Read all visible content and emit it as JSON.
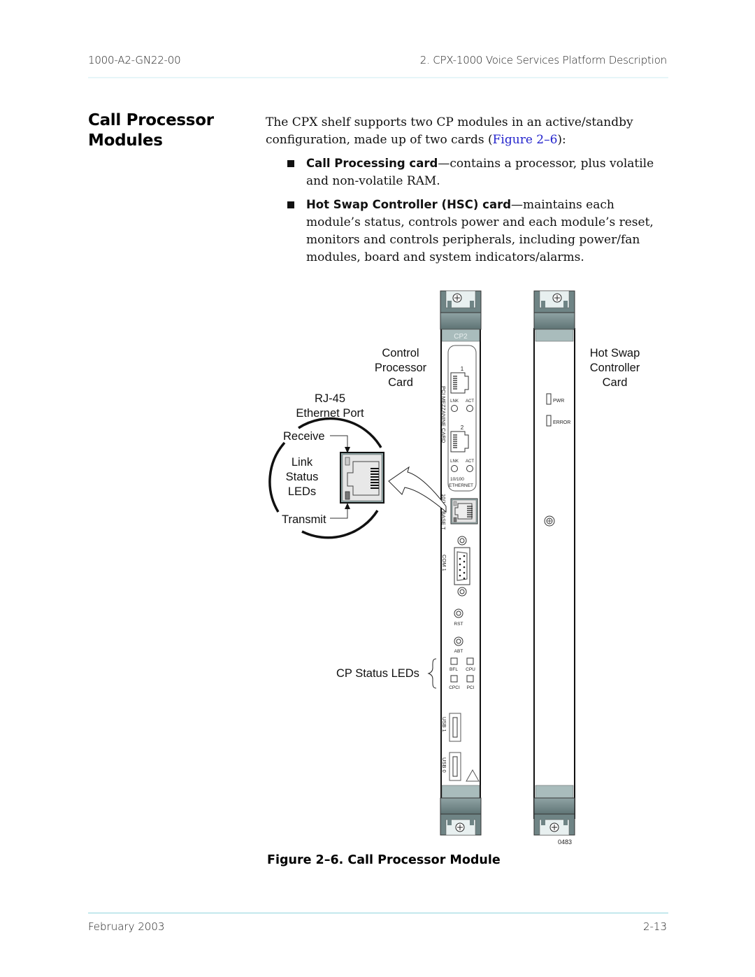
{
  "header": {
    "doc_id": "1000-A2-GN22-00",
    "chapter": "2. CPX-1000 Voice Services Platform Description"
  },
  "section": {
    "title_line1": "Call Processor",
    "title_line2": "Modules"
  },
  "body": {
    "intro_before_link": "The CPX shelf supports two CP modules in an active/standby configuration, made up of two cards (",
    "intro_link": "Figure 2–6",
    "intro_after_link": "):",
    "bullets": [
      {
        "bold": "Call Processing card",
        "text": "—contains a processor, plus volatile and non-volatile RAM."
      },
      {
        "bold": "Hot Swap Controller (HSC) card",
        "text": "—maintains each module’s status, controls power and each module’s reset, monitors and controls peripherals, including power/fan modules, board and system indicators/alarms."
      }
    ]
  },
  "figure": {
    "labels": {
      "control_processor_card": [
        "Control",
        "Processor",
        "Card"
      ],
      "hot_swap_controller_card": [
        "Hot Swap",
        "Controller",
        "Card"
      ],
      "rj45": [
        "RJ-45",
        "Ethernet Port"
      ],
      "receive": "Receive",
      "link_status_leds": [
        "Link",
        "Status",
        "LEDs"
      ],
      "transmit": "Transmit",
      "cp_status_leds": "CP Status LEDs"
    },
    "cp_card": {
      "slot_label": "CP2",
      "mezzanine": "PCI MEZZANINE CARD",
      "port1": "1",
      "port2": "2",
      "lnk": "LNK",
      "act": "ACT",
      "eth_speed": "10/100",
      "eth_label": "ETHERNET",
      "base_t": "10/100 BASE T",
      "com": "COM 1",
      "rst": "RST",
      "abt": "ABT",
      "leds": [
        "BFL",
        "CPU",
        "CPCI",
        "PCI"
      ],
      "usb1": "USB 1",
      "usb0": "USB 0"
    },
    "hsc_card": {
      "pwr": "PWR",
      "error": "ERROR"
    },
    "figure_id": "0483",
    "caption": "Figure 2–6.  Call Processor Module"
  },
  "footer": {
    "date": "February 2003",
    "page": "2-13"
  },
  "colors": {
    "link": "#2222cc",
    "header_rule": "#e6f5f8",
    "footer_rule": "#8fd4dc",
    "handle_dark": "#6f8485",
    "handle_light": "#a9bcbc"
  }
}
